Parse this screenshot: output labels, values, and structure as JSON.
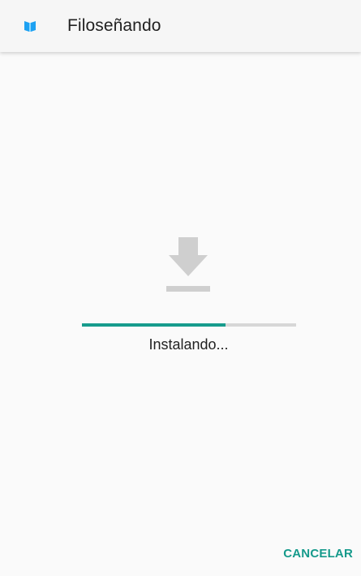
{
  "app_bar": {
    "title": "Filoseñando",
    "icon": "open-book-icon"
  },
  "install": {
    "icon": "download-icon",
    "progress_percent": 67,
    "status": "Instalando..."
  },
  "actions": {
    "cancel_label": "CANCELAR"
  },
  "colors": {
    "accent": "#179c8d",
    "progress_track": "#d7d7d7",
    "icon_gray": "#cfcfcf",
    "app_icon_blue": "#1da1f2"
  }
}
